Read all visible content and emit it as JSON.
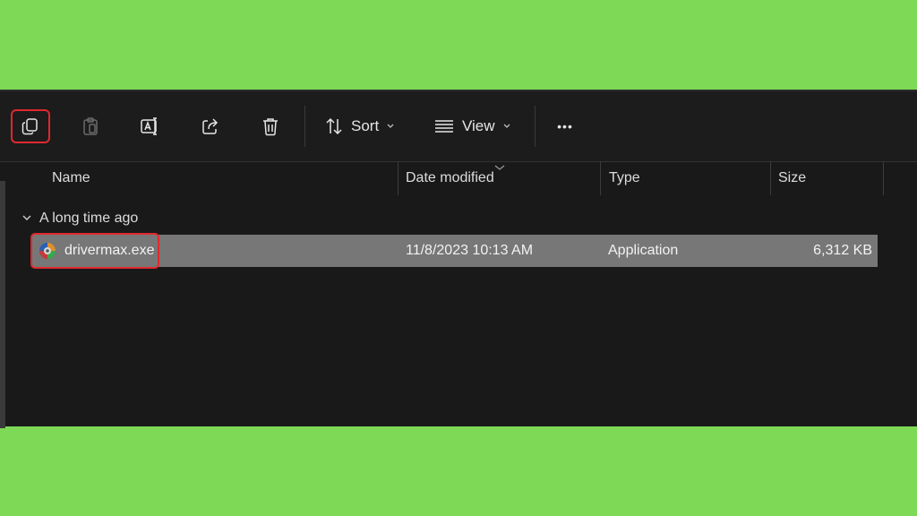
{
  "toolbar": {
    "buttons": [
      {
        "name": "copy",
        "icon": "copy-icon"
      },
      {
        "name": "paste",
        "icon": "paste-icon"
      },
      {
        "name": "rename",
        "icon": "rename-icon"
      },
      {
        "name": "share",
        "icon": "share-icon"
      },
      {
        "name": "delete",
        "icon": "delete-icon"
      }
    ],
    "sort_label": "Sort",
    "view_label": "View",
    "more_label": "•••"
  },
  "columns": {
    "name": "Name",
    "date_modified": "Date modified",
    "type": "Type",
    "size": "Size"
  },
  "group": {
    "label": "A long time ago"
  },
  "files": [
    {
      "name": "drivermax.exe",
      "date_modified": "11/8/2023 10:13 AM",
      "type": "Application",
      "size": "6,312 KB",
      "icon": "drivermax-app-icon"
    }
  ],
  "colors": {
    "background": "#7ed957",
    "window": "#191919",
    "selection": "#777777",
    "highlight": "#e0282e"
  }
}
